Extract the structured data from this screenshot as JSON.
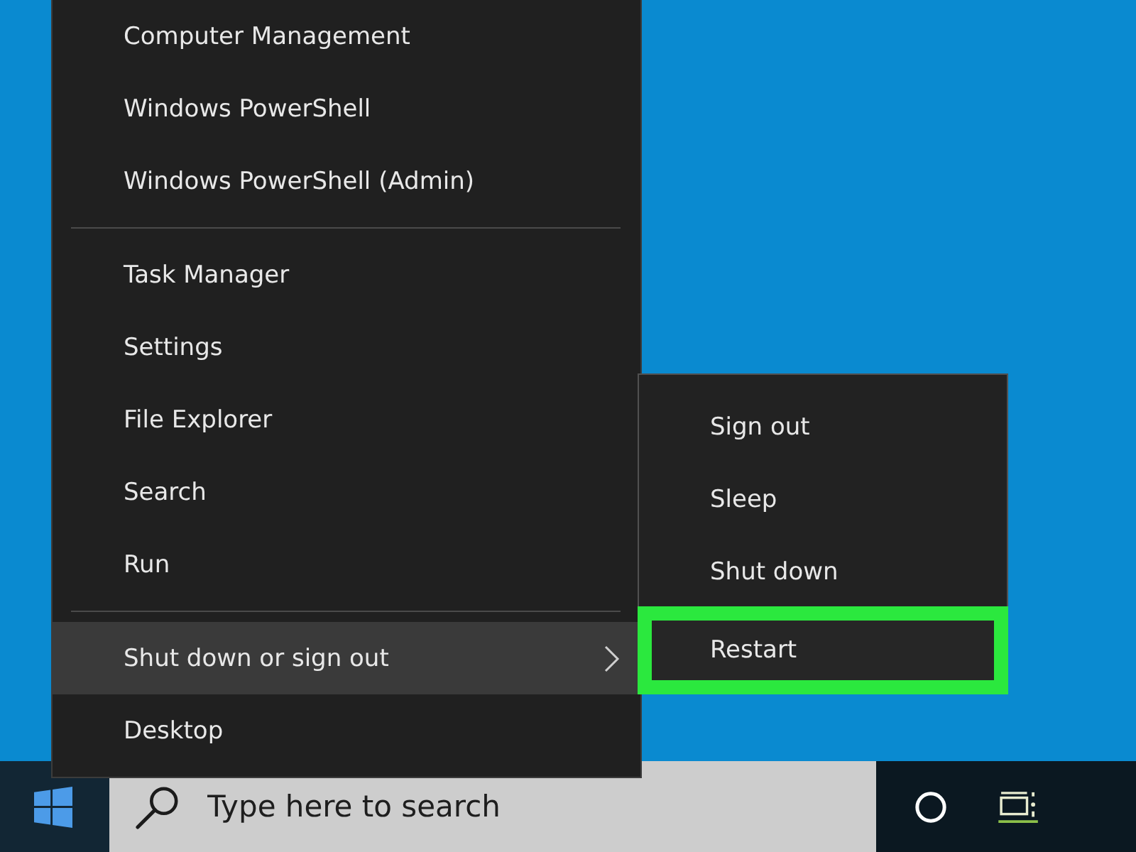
{
  "menu": {
    "groups": [
      {
        "items": [
          {
            "label": "Computer Management",
            "selected": false,
            "has_submenu": false
          },
          {
            "label": "Windows PowerShell",
            "selected": false,
            "has_submenu": false
          },
          {
            "label": "Windows PowerShell (Admin)",
            "selected": false,
            "has_submenu": false
          }
        ]
      },
      {
        "items": [
          {
            "label": "Task Manager",
            "selected": false,
            "has_submenu": false
          },
          {
            "label": "Settings",
            "selected": false,
            "has_submenu": false
          },
          {
            "label": "File Explorer",
            "selected": false,
            "has_submenu": false
          },
          {
            "label": "Search",
            "selected": false,
            "has_submenu": false
          },
          {
            "label": "Run",
            "selected": false,
            "has_submenu": false
          }
        ]
      },
      {
        "items": [
          {
            "label": "Shut down or sign out",
            "selected": true,
            "has_submenu": true
          },
          {
            "label": "Desktop",
            "selected": false,
            "has_submenu": false
          }
        ]
      }
    ]
  },
  "submenu": {
    "items": [
      {
        "label": "Sign out",
        "outlined": false
      },
      {
        "label": "Sleep",
        "outlined": false
      },
      {
        "label": "Shut down",
        "outlined": false
      },
      {
        "label": "Restart",
        "outlined": true
      }
    ]
  },
  "taskbar": {
    "search": {
      "placeholder": "Type here to search"
    }
  }
}
